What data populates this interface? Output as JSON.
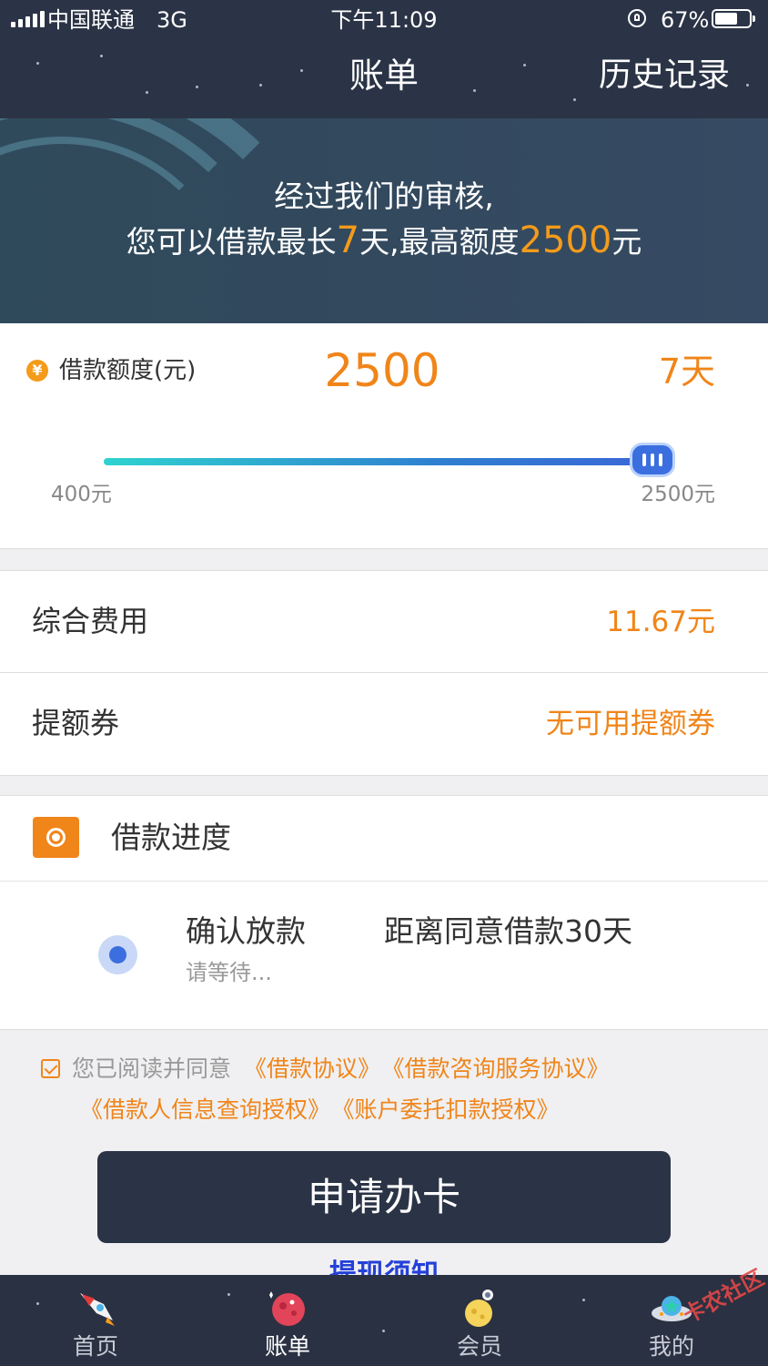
{
  "status_bar": {
    "carrier": "中国联通",
    "network": "3G",
    "time": "下午11:09",
    "battery": "67%",
    "battery_level": 0.67
  },
  "nav": {
    "title": "账单",
    "history_label": "历史记录"
  },
  "banner": {
    "line1": "经过我们的审核,",
    "line2_prefix": "您可以借款最长",
    "days": "7",
    "line2_mid": "天,最高额度",
    "amount": "2500",
    "line2_suffix": "元"
  },
  "loan": {
    "icon": "yen-icon",
    "label": "借款额度(元)",
    "amount": "2500",
    "days": "7天",
    "slider_min": "400元",
    "slider_max": "2500元",
    "slider_fraction": 1.0
  },
  "fees": [
    {
      "label": "综合费用",
      "value": "11.67元"
    },
    {
      "label": "提额券",
      "value": "无可用提额券"
    }
  ],
  "progress": {
    "title": "借款进度",
    "step_title": "确认放款",
    "step_sub": "请等待...",
    "step_note": "距离同意借款30天"
  },
  "agreement": {
    "prefix": "您已阅读并同意",
    "links": [
      "《借款协议》",
      "《借款咨询服务协议》",
      "《借款人信息查询授权》",
      "《账户委托扣款授权》"
    ]
  },
  "apply_button": "申请办卡",
  "notice_link": "提现须知",
  "tabs": [
    {
      "label": "首页",
      "icon": "rocket-icon",
      "active": false
    },
    {
      "label": "账单",
      "icon": "planet-icon",
      "active": true
    },
    {
      "label": "会员",
      "icon": "astronaut-moon-icon",
      "active": false
    },
    {
      "label": "我的",
      "icon": "ufo-icon",
      "active": false
    }
  ],
  "watermark": "卡农社区",
  "colors": {
    "accent": "#f08519",
    "dark": "#2b3446",
    "slider_start": "#2fd3d0",
    "slider_end": "#3a66d8"
  }
}
